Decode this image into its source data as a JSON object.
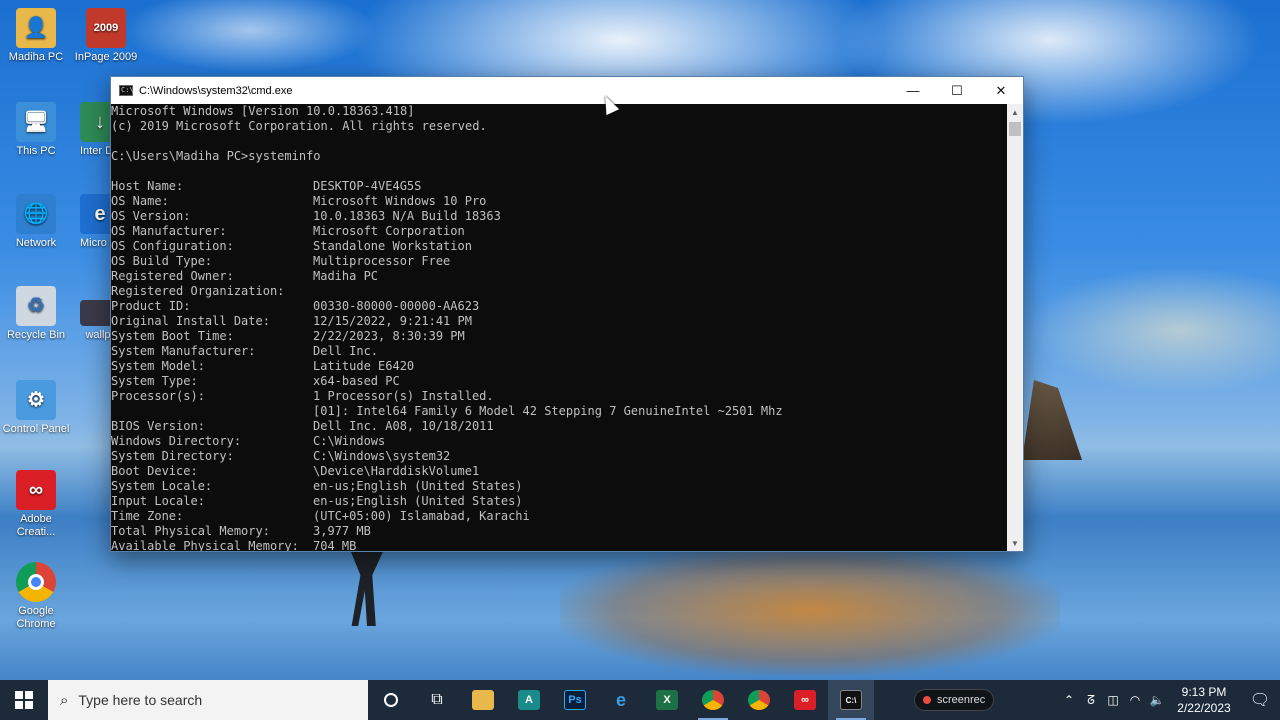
{
  "desktop": {
    "icons": [
      {
        "label": "Madiha PC"
      },
      {
        "label": "InPage 2009"
      },
      {
        "label": "This PC"
      },
      {
        "label": "Inter Down"
      },
      {
        "label": "Network"
      },
      {
        "label": "Micro Edg"
      },
      {
        "label": "Recycle Bin"
      },
      {
        "label": "wallp"
      },
      {
        "label": "Control Panel"
      },
      {
        "label": "Adobe Creati..."
      },
      {
        "label": "Google Chrome"
      }
    ]
  },
  "cmd": {
    "title": "C:\\Windows\\system32\\cmd.exe",
    "header_lines": [
      "Microsoft Windows [Version 10.0.18363.418]",
      "(c) 2019 Microsoft Corporation. All rights reserved.",
      "",
      "C:\\Users\\Madiha PC>systeminfo",
      ""
    ],
    "rows": [
      {
        "key": "Host Name:",
        "value": "DESKTOP-4VE4G5S"
      },
      {
        "key": "OS Name:",
        "value": "Microsoft Windows 10 Pro"
      },
      {
        "key": "OS Version:",
        "value": "10.0.18363 N/A Build 18363"
      },
      {
        "key": "OS Manufacturer:",
        "value": "Microsoft Corporation"
      },
      {
        "key": "OS Configuration:",
        "value": "Standalone Workstation"
      },
      {
        "key": "OS Build Type:",
        "value": "Multiprocessor Free"
      },
      {
        "key": "Registered Owner:",
        "value": "Madiha PC"
      },
      {
        "key": "Registered Organization:",
        "value": ""
      },
      {
        "key": "Product ID:",
        "value": "00330-80000-00000-AA623"
      },
      {
        "key": "Original Install Date:",
        "value": "12/15/2022, 9:21:41 PM"
      },
      {
        "key": "System Boot Time:",
        "value": "2/22/2023, 8:30:39 PM"
      },
      {
        "key": "System Manufacturer:",
        "value": "Dell Inc."
      },
      {
        "key": "System Model:",
        "value": "Latitude E6420"
      },
      {
        "key": "System Type:",
        "value": "x64-based PC"
      },
      {
        "key": "Processor(s):",
        "value": "1 Processor(s) Installed."
      },
      {
        "key": "",
        "value": "[01]: Intel64 Family 6 Model 42 Stepping 7 GenuineIntel ~2501 Mhz"
      },
      {
        "key": "BIOS Version:",
        "value": "Dell Inc. A08, 10/18/2011"
      },
      {
        "key": "Windows Directory:",
        "value": "C:\\Windows"
      },
      {
        "key": "System Directory:",
        "value": "C:\\Windows\\system32"
      },
      {
        "key": "Boot Device:",
        "value": "\\Device\\HarddiskVolume1"
      },
      {
        "key": "System Locale:",
        "value": "en-us;English (United States)"
      },
      {
        "key": "Input Locale:",
        "value": "en-us;English (United States)"
      },
      {
        "key": "Time Zone:",
        "value": "(UTC+05:00) Islamabad, Karachi"
      },
      {
        "key": "Total Physical Memory:",
        "value": "3,977 MB"
      },
      {
        "key": "Available Physical Memory:",
        "value": "704 MB"
      }
    ],
    "buttons": {
      "minimize": "—",
      "maximize": "☐",
      "close": "✕"
    }
  },
  "taskbar": {
    "search_placeholder": "Type here to search",
    "screenrec_label": "screenrec",
    "clock_time": "9:13 PM",
    "clock_date": "2/22/2023"
  },
  "colors": {
    "console_bg": "#0c0c0c",
    "console_text": "#c0c0c0",
    "taskbar_bg": "#1c2a3a"
  }
}
